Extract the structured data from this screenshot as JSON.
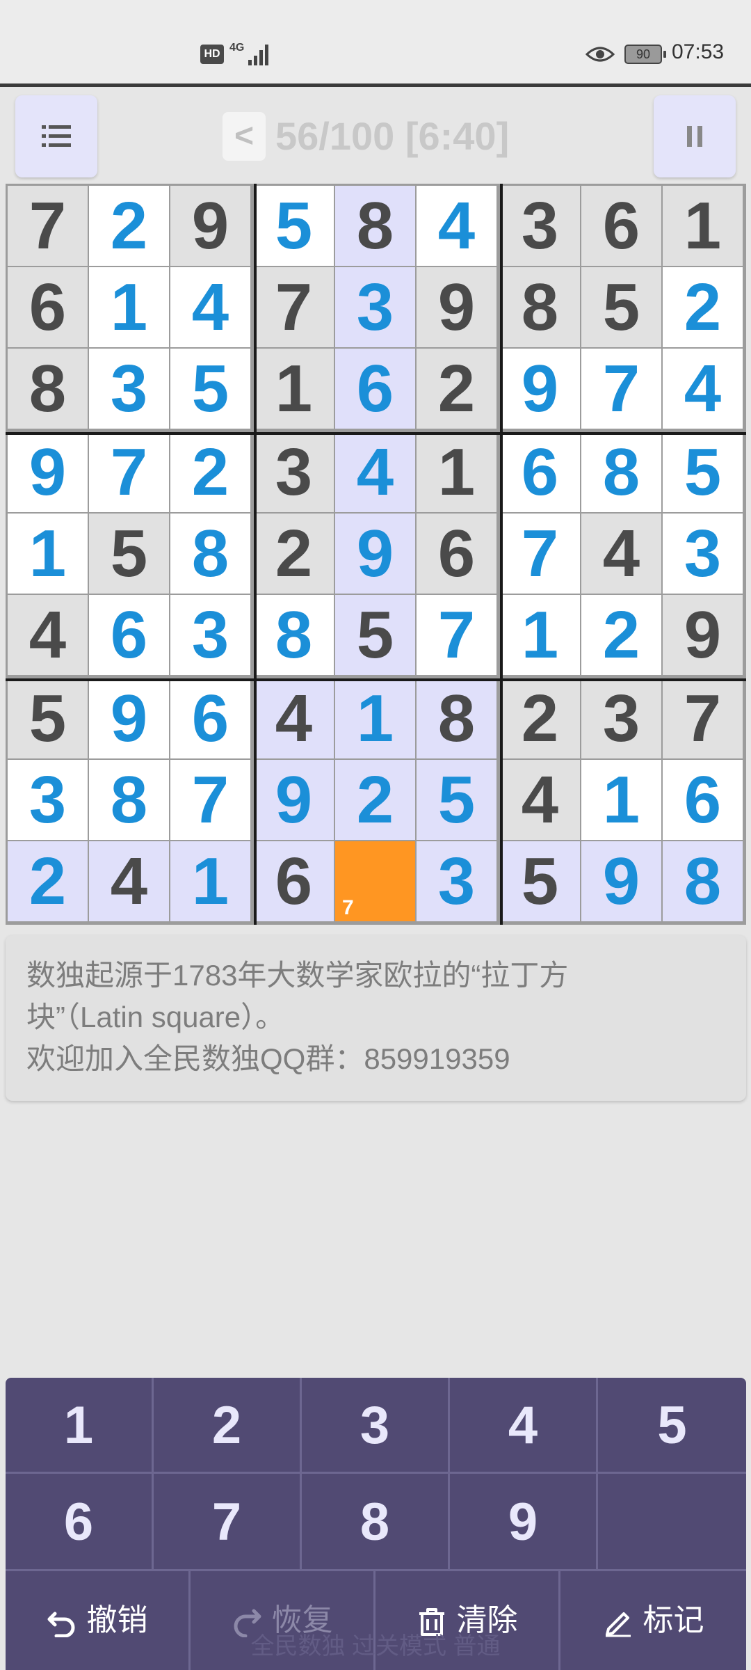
{
  "status_bar": {
    "hd": "HD",
    "network": "4G",
    "battery": "90",
    "time": "07:53"
  },
  "toolbar": {
    "back_label": "<",
    "progress": "56/100 [6:40]"
  },
  "grid": {
    "cells": [
      [
        {
          "v": "7",
          "t": "given"
        },
        {
          "v": "2",
          "t": "user"
        },
        {
          "v": "9",
          "t": "given"
        },
        {
          "v": "5",
          "t": "user"
        },
        {
          "v": "8",
          "t": "given"
        },
        {
          "v": "4",
          "t": "user"
        },
        {
          "v": "3",
          "t": "given"
        },
        {
          "v": "6",
          "t": "given"
        },
        {
          "v": "1",
          "t": "given"
        }
      ],
      [
        {
          "v": "6",
          "t": "given"
        },
        {
          "v": "1",
          "t": "user"
        },
        {
          "v": "4",
          "t": "user"
        },
        {
          "v": "7",
          "t": "given"
        },
        {
          "v": "3",
          "t": "user"
        },
        {
          "v": "9",
          "t": "given"
        },
        {
          "v": "8",
          "t": "given"
        },
        {
          "v": "5",
          "t": "given"
        },
        {
          "v": "2",
          "t": "user"
        }
      ],
      [
        {
          "v": "8",
          "t": "given"
        },
        {
          "v": "3",
          "t": "user"
        },
        {
          "v": "5",
          "t": "user"
        },
        {
          "v": "1",
          "t": "given"
        },
        {
          "v": "6",
          "t": "user"
        },
        {
          "v": "2",
          "t": "given"
        },
        {
          "v": "9",
          "t": "user"
        },
        {
          "v": "7",
          "t": "user"
        },
        {
          "v": "4",
          "t": "user"
        }
      ],
      [
        {
          "v": "9",
          "t": "user"
        },
        {
          "v": "7",
          "t": "user"
        },
        {
          "v": "2",
          "t": "user"
        },
        {
          "v": "3",
          "t": "given"
        },
        {
          "v": "4",
          "t": "user"
        },
        {
          "v": "1",
          "t": "given"
        },
        {
          "v": "6",
          "t": "user"
        },
        {
          "v": "8",
          "t": "user"
        },
        {
          "v": "5",
          "t": "user"
        }
      ],
      [
        {
          "v": "1",
          "t": "user"
        },
        {
          "v": "5",
          "t": "given"
        },
        {
          "v": "8",
          "t": "user"
        },
        {
          "v": "2",
          "t": "given"
        },
        {
          "v": "9",
          "t": "user"
        },
        {
          "v": "6",
          "t": "given"
        },
        {
          "v": "7",
          "t": "user"
        },
        {
          "v": "4",
          "t": "given"
        },
        {
          "v": "3",
          "t": "user"
        }
      ],
      [
        {
          "v": "4",
          "t": "given"
        },
        {
          "v": "6",
          "t": "user"
        },
        {
          "v": "3",
          "t": "user"
        },
        {
          "v": "8",
          "t": "user"
        },
        {
          "v": "5",
          "t": "given"
        },
        {
          "v": "7",
          "t": "user"
        },
        {
          "v": "1",
          "t": "user"
        },
        {
          "v": "2",
          "t": "user"
        },
        {
          "v": "9",
          "t": "given"
        }
      ],
      [
        {
          "v": "5",
          "t": "given"
        },
        {
          "v": "9",
          "t": "user"
        },
        {
          "v": "6",
          "t": "user"
        },
        {
          "v": "4",
          "t": "given"
        },
        {
          "v": "1",
          "t": "user"
        },
        {
          "v": "8",
          "t": "given"
        },
        {
          "v": "2",
          "t": "given"
        },
        {
          "v": "3",
          "t": "given"
        },
        {
          "v": "7",
          "t": "given"
        }
      ],
      [
        {
          "v": "3",
          "t": "user"
        },
        {
          "v": "8",
          "t": "user"
        },
        {
          "v": "7",
          "t": "user"
        },
        {
          "v": "9",
          "t": "user"
        },
        {
          "v": "2",
          "t": "user"
        },
        {
          "v": "5",
          "t": "user"
        },
        {
          "v": "4",
          "t": "given"
        },
        {
          "v": "1",
          "t": "user"
        },
        {
          "v": "6",
          "t": "user"
        }
      ],
      [
        {
          "v": "2",
          "t": "user"
        },
        {
          "v": "4",
          "t": "given"
        },
        {
          "v": "1",
          "t": "user"
        },
        {
          "v": "6",
          "t": "given"
        },
        {
          "v": "",
          "t": "selected",
          "note": "7"
        },
        {
          "v": "3",
          "t": "user"
        },
        {
          "v": "5",
          "t": "given"
        },
        {
          "v": "9",
          "t": "user"
        },
        {
          "v": "8",
          "t": "user"
        }
      ]
    ],
    "selected": {
      "row": 8,
      "col": 4
    },
    "colors": {
      "given_bg": "#e1e1e1",
      "user_bg": "#ffffff",
      "highlight_bg": "#e0e0fa",
      "selected_bg": "#ff9622",
      "given_text": "#4a4a4a",
      "user_text": "#1b8fd8"
    }
  },
  "info": {
    "line1": "数独起源于1783年大数学家欧拉的“拉丁方",
    "line2": "块”（Latin square）。",
    "line3": "欢迎加入全民数独QQ群：859919359"
  },
  "keypad": {
    "keys": [
      "1",
      "2",
      "3",
      "4",
      "5",
      "6",
      "7",
      "8",
      "9"
    ],
    "undo": "撤销",
    "redo": "恢复",
    "clear": "清除",
    "mark": "标记",
    "footer": "全民数独 过关模式 普通"
  },
  "icons": [
    "hd-icon",
    "signal-icon",
    "eye-icon",
    "battery-icon",
    "menu-icon",
    "pause-icon",
    "undo-icon",
    "redo-icon",
    "trash-icon",
    "pencil-icon"
  ]
}
